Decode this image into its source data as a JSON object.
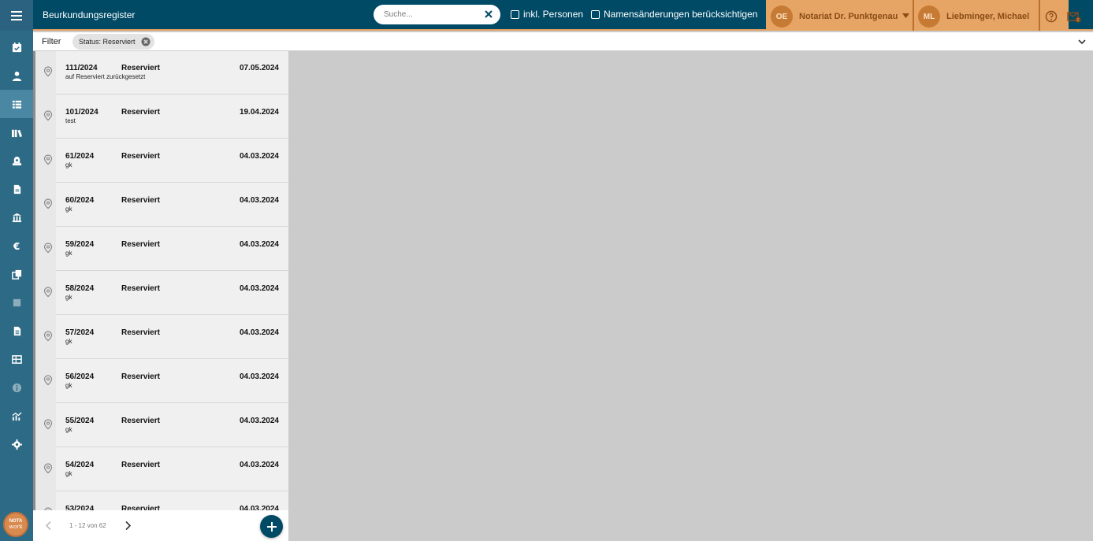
{
  "header": {
    "title": "Beurkundungsregister",
    "search_placeholder": "Suche...",
    "include_persons_label": "inkl. Personen",
    "name_changes_label": "Namensänderungen berücksichtigen",
    "office_initials": "OE",
    "office_name": "Notariat Dr. Punktgenau",
    "user_initials": "ML",
    "user_name": "Liebminger, Michael"
  },
  "filter": {
    "label": "Filter",
    "chip_label": "Status: Reserviert"
  },
  "sidebar": {
    "items": [
      "calendar-check-icon",
      "person-icon",
      "table-list-icon",
      "books-icon",
      "safe-icon",
      "document-icon",
      "bank-icon",
      "euro-icon",
      "copy-icon",
      "square-icon",
      "file-text-icon",
      "ledger-icon",
      "info-icon",
      "chart-icon",
      "gear-icon"
    ],
    "active_index": 2,
    "logo_top": "NOTA",
    "logo_bottom": "work"
  },
  "entries": [
    {
      "number": "111/2024",
      "status": "Reserviert",
      "date": "07.05.2024",
      "note": "auf Reserviert zurückgesetzt"
    },
    {
      "number": "101/2024",
      "status": "Reserviert",
      "date": "19.04.2024",
      "note": "test"
    },
    {
      "number": "61/2024",
      "status": "Reserviert",
      "date": "04.03.2024",
      "note": "gk"
    },
    {
      "number": "60/2024",
      "status": "Reserviert",
      "date": "04.03.2024",
      "note": "gk"
    },
    {
      "number": "59/2024",
      "status": "Reserviert",
      "date": "04.03.2024",
      "note": "gk"
    },
    {
      "number": "58/2024",
      "status": "Reserviert",
      "date": "04.03.2024",
      "note": "gk"
    },
    {
      "number": "57/2024",
      "status": "Reserviert",
      "date": "04.03.2024",
      "note": "gk"
    },
    {
      "number": "56/2024",
      "status": "Reserviert",
      "date": "04.03.2024",
      "note": "gk"
    },
    {
      "number": "55/2024",
      "status": "Reserviert",
      "date": "04.03.2024",
      "note": "gk"
    },
    {
      "number": "54/2024",
      "status": "Reserviert",
      "date": "04.03.2024",
      "note": "gk"
    },
    {
      "number": "53/2024",
      "status": "Reserviert",
      "date": "04.03.2024",
      "note": ""
    }
  ],
  "pagination": {
    "info": "1 - 12 von 62"
  },
  "colors": {
    "topbar": "#004a66",
    "sidebar": "#2d6a86",
    "accent_orange": "#e6a565",
    "content_bg": "#cbcbcb"
  }
}
